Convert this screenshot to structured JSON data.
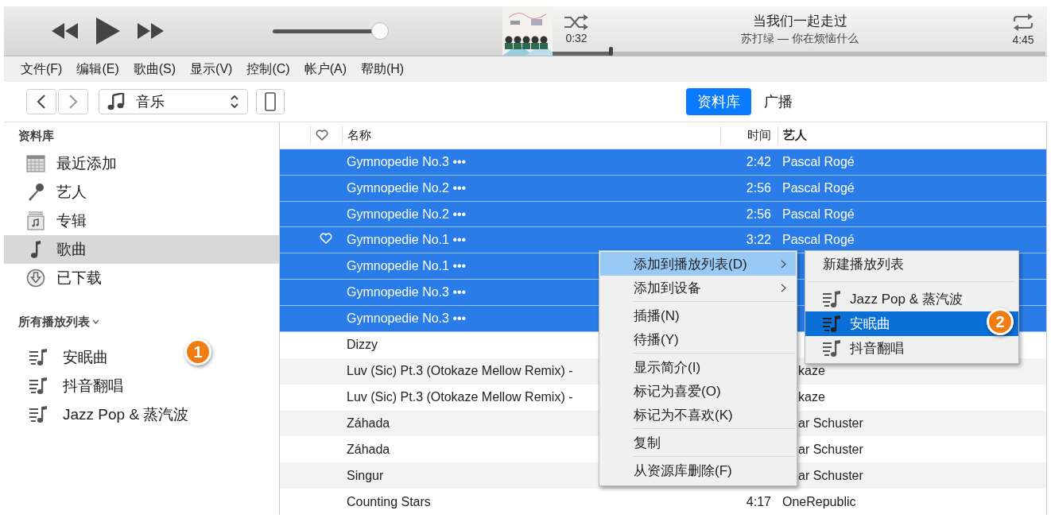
{
  "player": {
    "volume": {
      "level": 0.95
    },
    "now_playing": {
      "title": "当我们一起走过",
      "subtitle": "苏打绿 — 你在烦恼什么",
      "elapsed": "0:32",
      "duration": "4:45",
      "progress": {
        "level": 0.12
      }
    }
  },
  "menu_bar": [
    "文件(F)",
    "编辑(E)",
    "歌曲(S)",
    "显示(V)",
    "控制(C)",
    "帐户(A)",
    "帮助(H)"
  ],
  "toolbar": {
    "media_select": "音乐",
    "tabs": [
      {
        "label": "资料库",
        "selected": true
      },
      {
        "label": "广播",
        "selected": false
      }
    ]
  },
  "sidebar": {
    "library_heading": "资料库",
    "items": [
      {
        "label": "最近添加",
        "kind": "calendar",
        "selected": false
      },
      {
        "label": "艺人",
        "kind": "mic",
        "selected": false
      },
      {
        "label": "专辑",
        "kind": "album",
        "selected": false
      },
      {
        "label": "歌曲",
        "kind": "note",
        "selected": true
      },
      {
        "label": "已下载",
        "kind": "download",
        "selected": false
      }
    ],
    "playlists_heading": "所有播放列表",
    "playlists": [
      "安眠曲",
      "抖音翻唱",
      "Jazz Pop & 蒸汽波"
    ]
  },
  "table": {
    "columns": [
      "名称",
      "时间",
      "艺人"
    ],
    "rows": [
      {
        "name": "Gymnopedie No.3 •••",
        "time": "2:42",
        "artist": "Pascal Rogé",
        "loved": false,
        "selected": true
      },
      {
        "name": "Gymnopedie No.2 •••",
        "time": "2:56",
        "artist": "Pascal Rogé",
        "loved": false,
        "selected": true
      },
      {
        "name": "Gymnopedie No.2 •••",
        "time": "2:56",
        "artist": "Pascal Rogé",
        "loved": false,
        "selected": true
      },
      {
        "name": "Gymnopedie No.1 •••",
        "time": "3:22",
        "artist": "Pascal Rogé",
        "loved": true,
        "selected": true
      },
      {
        "name": "Gymnopedie No.1 •••",
        "loved": false,
        "selected": true
      },
      {
        "name": "Gymnopedie No.3 •••",
        "loved": false,
        "selected": true
      },
      {
        "name": "Gymnopedie No.3 •••",
        "loved": false,
        "selected": true
      },
      {
        "name": "Dizzy",
        "loved": false,
        "selected": false
      },
      {
        "name": "Luv (Sic) Pt.3 (Otokaze Mellow Remix) -",
        "artist": "kaze",
        "loved": false,
        "selected": false
      },
      {
        "name": "Luv (Sic) Pt.3 (Otokaze Mellow Remix) -",
        "artist": "kaze",
        "loved": false,
        "selected": false
      },
      {
        "name": "Záhada",
        "artist": "ar Schuster",
        "loved": false,
        "selected": false
      },
      {
        "name": "Záhada",
        "artist": "ar Schuster",
        "loved": false,
        "selected": false
      },
      {
        "name": "Singur",
        "artist": "ar Schuster",
        "loved": false,
        "selected": false
      },
      {
        "name": "Counting Stars",
        "time": "4:17",
        "artist": "OneRepublic",
        "loved": false,
        "selected": false
      }
    ]
  },
  "context_menu": {
    "groups": [
      [
        {
          "label": "添加到播放列表(D)",
          "submenu": true,
          "selected": true
        },
        {
          "label": "添加到设备",
          "submenu": true,
          "selected": false
        }
      ],
      [
        {
          "label": "插播(N)",
          "submenu": false,
          "selected": false
        },
        {
          "label": "待播(Y)",
          "submenu": false,
          "selected": false
        }
      ],
      [
        {
          "label": "显示简介(I)",
          "submenu": false,
          "selected": false
        },
        {
          "label": "标记为喜爱(O)",
          "submenu": false,
          "selected": false
        },
        {
          "label": "标记为不喜欢(K)",
          "submenu": false,
          "selected": false
        }
      ],
      [
        {
          "label": "复制",
          "submenu": false,
          "selected": false
        }
      ],
      [
        {
          "label": "从资源库删除(F)",
          "submenu": false,
          "selected": false
        }
      ]
    ]
  },
  "submenu": {
    "new_item": "新建播放列表",
    "playlists": [
      {
        "label": "Jazz Pop & 蒸汽波",
        "selected": false
      },
      {
        "label": "安眠曲",
        "selected": true
      },
      {
        "label": "抖音翻唱",
        "selected": false
      }
    ]
  },
  "callouts": [
    "1",
    "2"
  ]
}
